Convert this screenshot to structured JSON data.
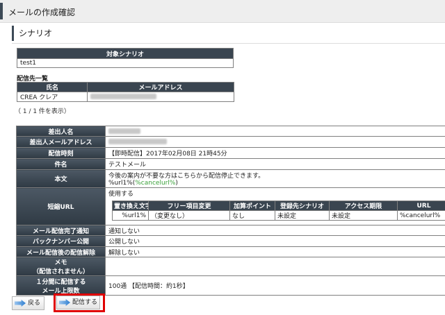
{
  "header": {
    "title": "メールの作成確認"
  },
  "section": {
    "title": "シナリオ"
  },
  "scenario_table": {
    "header": "対象シナリオ",
    "value": "test1"
  },
  "recipients": {
    "label": "配信先一覧",
    "columns": [
      "氏名",
      "メールアドレス"
    ],
    "rows": [
      {
        "name": "CREA クレア"
      }
    ],
    "count": "（ 1 / 1 件を表示）"
  },
  "details": {
    "sender_name_label": "差出人名",
    "sender_email_label": "差出人メールアドレス",
    "delivery_time_label": "配信時刻",
    "delivery_time_value": "【即時配信】2017年02月08日 21時45分",
    "subject_label": "件名",
    "subject_value": "テストメール",
    "body_label": "本文",
    "body_line1": "今後の案内が不要な方はこちらから配信停止できます。",
    "body_line2_prefix": "%url1%(",
    "body_line2_tag": "%cancelurl%",
    "body_line2_suffix": ")",
    "short_url_label": "短縮URL",
    "short_url_usage": "使用する",
    "url_columns": [
      "置き換え文字",
      "フリー項目変更",
      "加算ポイント",
      "登録先シナリオ",
      "アクセス期限",
      "URL"
    ],
    "url_row": [
      "%url1%",
      "（変更なし）",
      "なし",
      "未設定",
      "未設定",
      "%cancelurl%"
    ],
    "complete_notice_label": "メール配信完了通知",
    "complete_notice_value": "通知しない",
    "backnumber_label": "バックナンバー公開",
    "backnumber_value": "公開しない",
    "unsubscribe_label": "メール配信後の配信解除",
    "unsubscribe_value": "解除しない",
    "memo_label_1": "メモ",
    "memo_label_2": "（配信されません）",
    "limit_label_1": "１分間に配信する",
    "limit_label_2": "メール上限数",
    "limit_value": "100通 【配信時間：約1秒】"
  },
  "buttons": {
    "back": "戻る",
    "send": "配信する"
  }
}
